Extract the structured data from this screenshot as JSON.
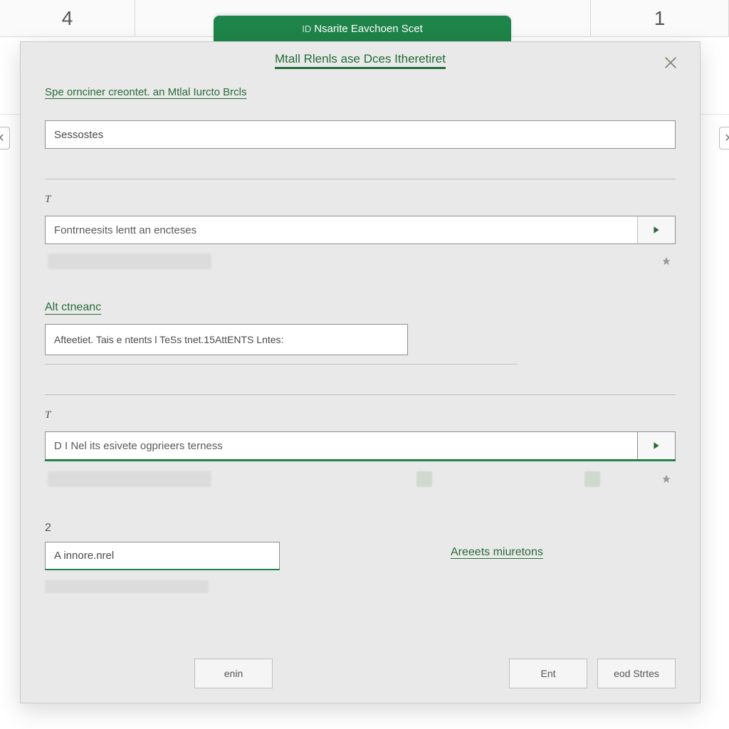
{
  "sheet": {
    "col_a": "4",
    "col_c": "1",
    "tab_prefix": "ID",
    "tab_label": "Nsarite Eavchoen Scet"
  },
  "dialog": {
    "title": "Mtall Rlenls ase Dces Itheretiret",
    "intro_link": "Spe ornciner creontet. an Mtlal Iurcto Brcls",
    "search_value": "Sessostes",
    "section1": {
      "label": "T",
      "combo_value": "Fontrneesits lentt an encteses"
    },
    "section2": {
      "heading": "Alt ctneanc",
      "input_value": "Afteetiet. Tais e ntents l TeSs tnet.15AttENTS Lntes:"
    },
    "section3": {
      "label": "T",
      "combo_value": "D I Nel its esivete ogprieers terness"
    },
    "section4": {
      "num": "2",
      "input_value": "A innore.nrel",
      "side_link": "Areeets miuretons"
    },
    "buttons": {
      "main": "enin",
      "ent": "Ent",
      "save": "eod Strtes"
    }
  }
}
